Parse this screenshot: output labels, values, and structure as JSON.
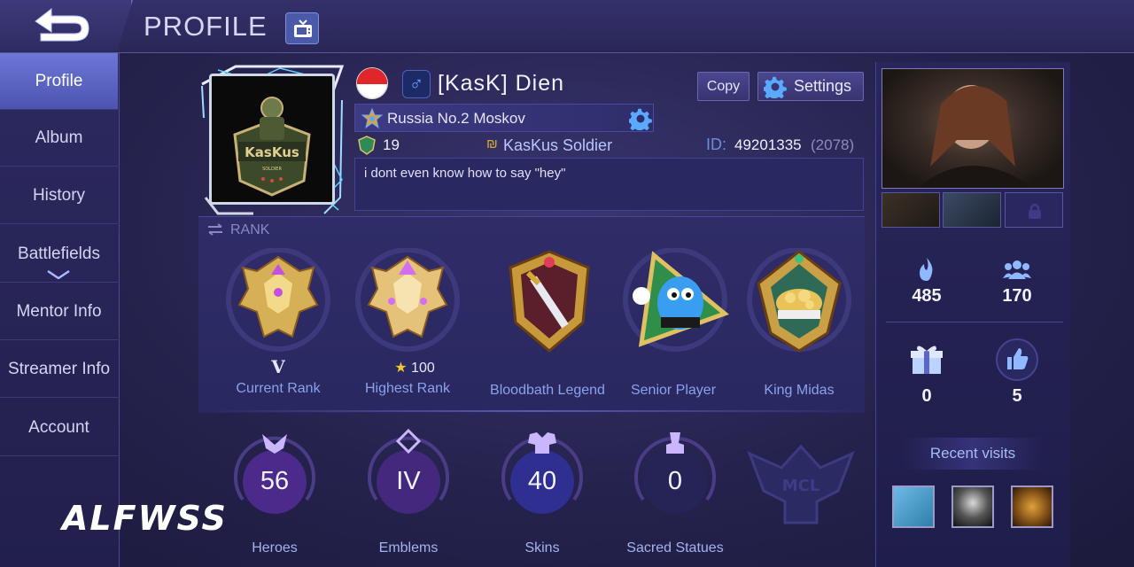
{
  "header": {
    "title": "PROFILE"
  },
  "sidebar": {
    "items": [
      {
        "label": "Profile"
      },
      {
        "label": "Album"
      },
      {
        "label": "History"
      },
      {
        "label": "Battlefields"
      },
      {
        "label": "Mentor Info"
      },
      {
        "label": "Streamer Info"
      },
      {
        "label": "Account"
      }
    ]
  },
  "player": {
    "name": "[KasK]  Dien",
    "location": "Russia No.2 Moskov",
    "level": "19",
    "squad": "KasKus Soldier",
    "id_label": "ID:",
    "id_value": "49201335",
    "id_extra": "(2078)",
    "bio": "i dont even know how to say \"hey\"",
    "avatar_logo_text": "KasKus"
  },
  "buttons": {
    "copy": "Copy",
    "settings": "Settings"
  },
  "rank": {
    "title": "RANK",
    "badges": [
      {
        "label": "Current Rank",
        "sub": "V",
        "icon": "mythic-rank-badge"
      },
      {
        "label": "Highest Rank",
        "sub": "100",
        "icon": "mythic-glory-badge"
      },
      {
        "label": "Bloodbath Legend",
        "sub": "",
        "icon": "sword-shield-badge"
      },
      {
        "label": "Senior Player",
        "sub": "",
        "icon": "blue-mascot-badge"
      },
      {
        "label": "King Midas",
        "sub": "",
        "icon": "treasure-shield-badge"
      }
    ]
  },
  "stats": [
    {
      "label": "Heroes",
      "value": "56"
    },
    {
      "label": "Emblems",
      "value": "IV"
    },
    {
      "label": "Skins",
      "value": "40"
    },
    {
      "label": "Sacred Statues",
      "value": "0"
    }
  ],
  "right": {
    "popularity": "485",
    "followers": "170",
    "gifts": "0",
    "likes": "5",
    "recent_visits_label": "Recent visits"
  },
  "watermark": "ALFWSS",
  "colors": {
    "accent": "#5c66cf",
    "panel": "#2a2860",
    "label": "#8aa2ea"
  }
}
